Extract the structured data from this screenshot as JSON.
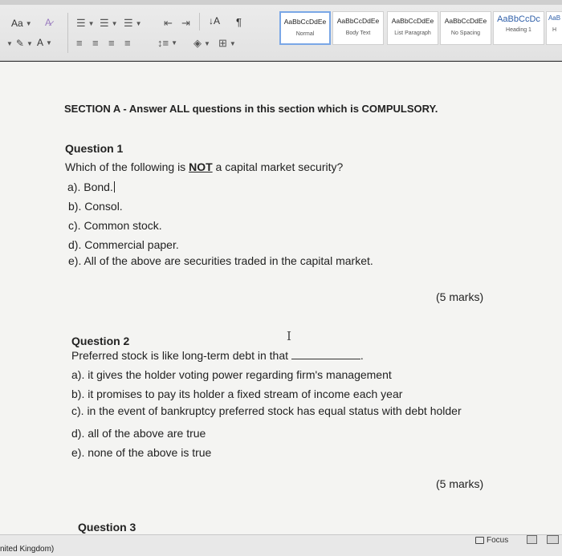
{
  "ribbon": {
    "font_size_label": "Aa",
    "style_gallery": [
      {
        "sample": "AaBbCcDdEe",
        "name": "Normal",
        "selected": true
      },
      {
        "sample": "AaBbCcDdEe",
        "name": "Body Text"
      },
      {
        "sample": "AaBbCcDdEe",
        "name": "List Paragraph"
      },
      {
        "sample": "AaBbCcDdEe",
        "name": "No Spacing"
      },
      {
        "sample": "AaBbCcDc",
        "name": "Heading 1",
        "heading": true
      },
      {
        "sample": "AaB",
        "name": "H"
      }
    ]
  },
  "document": {
    "section_heading": "SECTION A - Answer ALL questions in this section which is COMPULSORY.",
    "question1": {
      "title": "Question 1",
      "prompt_before": "Which of the following is ",
      "prompt_emphasis": "NOT",
      "prompt_after": " a capital market security?",
      "options": [
        "a). Bond.",
        "b). Consol.",
        "c). Common stock.",
        "d). Commercial paper.",
        "e). All of the above are securities traded in the capital market."
      ],
      "marks": "(5 marks)"
    },
    "question2": {
      "title": "Question 2",
      "prompt_before": "Preferred stock is like long-term debt in that ",
      "prompt_after": ".",
      "options": [
        "a). it gives the holder voting power regarding firm's management",
        "b). it promises to pay its holder a fixed stream of income each year",
        "c). in the event of bankruptcy preferred stock has equal status with debt holder",
        "d). all of the above are true",
        "e). none of the above is true"
      ],
      "marks": "(5 marks)"
    },
    "question3": {
      "title": "Question 3"
    }
  },
  "statusbar": {
    "language": "nited Kingdom)",
    "focus_label": "Focus"
  }
}
